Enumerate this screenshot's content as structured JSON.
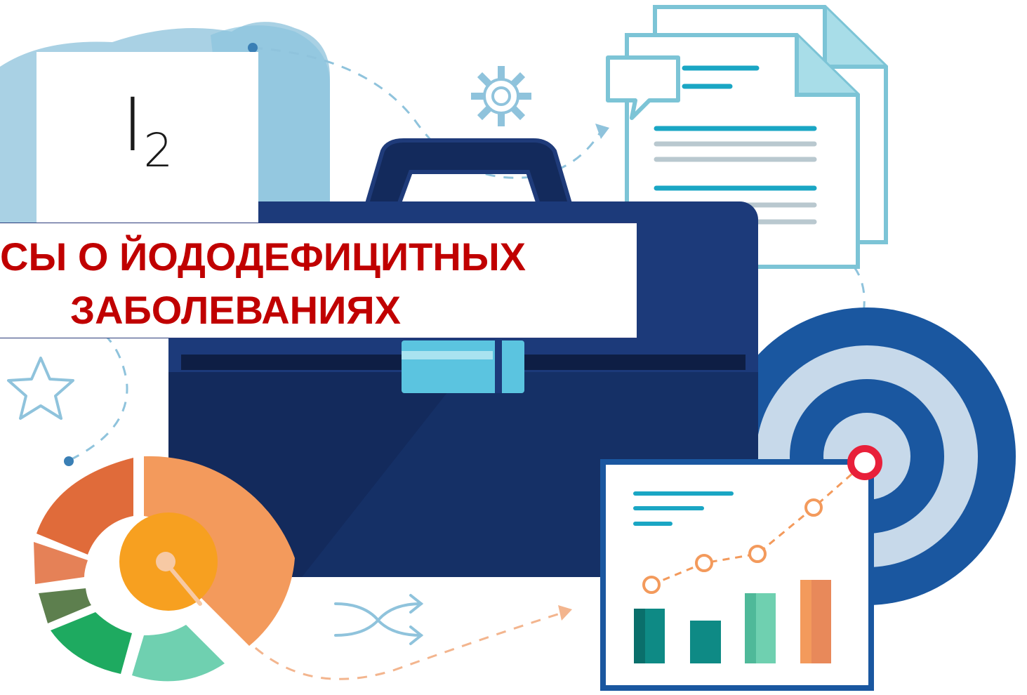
{
  "logo": {
    "element_symbol": "I",
    "subscript": "2"
  },
  "title": {
    "line1": "СЫ О ЙОДОДЕФИЦИТНЫХ",
    "line2": "ЗАБОЛЕВАНИЯХ"
  },
  "colors": {
    "title_red": "#c00000",
    "briefcase_navy": "#1c3a7a",
    "briefcase_dark": "#132a5c",
    "accent_teal": "#1aa6c4",
    "light_blue": "#8cc4de",
    "orange": "#f39a5c",
    "teal_dark": "#0e8a85",
    "green": "#1eaa60"
  }
}
